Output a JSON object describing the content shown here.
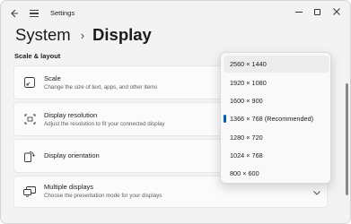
{
  "window": {
    "title": "Settings"
  },
  "breadcrumb": {
    "parent": "System",
    "separator": "›",
    "current": "Display"
  },
  "section": {
    "title": "Scale & layout"
  },
  "cards": {
    "scale": {
      "title": "Scale",
      "subtitle": "Change the size of text, apps, and other items"
    },
    "resolution": {
      "title": "Display resolution",
      "subtitle": "Adjust the resolution to fit your connected display"
    },
    "orientation": {
      "title": "Display orientation"
    },
    "multiple": {
      "title": "Multiple displays",
      "subtitle": "Choose the presentation mode for your displays"
    }
  },
  "resolution_dropdown": {
    "options": [
      "2560 × 1440",
      "1920 × 1080",
      "1600 × 900",
      "1366 × 768 (Recommended)",
      "1280 × 720",
      "1024 × 768",
      "800 × 600"
    ],
    "selected": "1366 × 768 (Recommended)",
    "hovered": "2560 × 1440"
  },
  "colors": {
    "accent": "#005fb8",
    "window_bg": "#f3f3f3",
    "card_bg": "#fbfbfb"
  },
  "icons": {
    "back": "back-arrow-icon",
    "menu": "hamburger-menu-icon",
    "minimize": "minimize-icon",
    "maximize": "maximize-icon",
    "close": "close-icon",
    "scale": "scale-icon",
    "resolution": "resolution-icon",
    "orientation": "orientation-icon",
    "multiple": "multiple-displays-icon",
    "chevron": "chevron-icon"
  }
}
